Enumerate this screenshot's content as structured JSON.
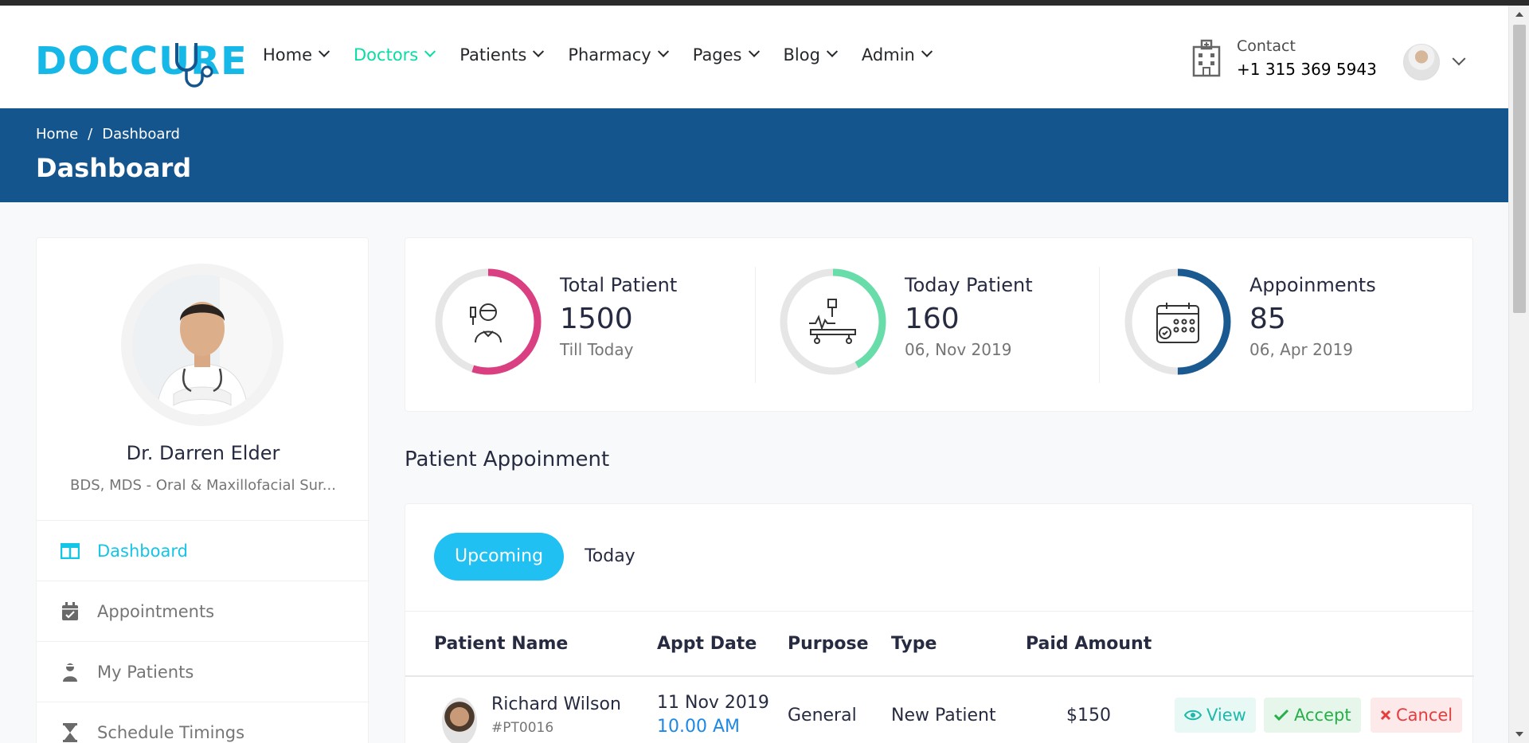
{
  "logo": {
    "text": "DOCCURE"
  },
  "nav": {
    "items": [
      {
        "label": "Home",
        "active": false
      },
      {
        "label": "Doctors",
        "active": true
      },
      {
        "label": "Patients",
        "active": false
      },
      {
        "label": "Pharmacy",
        "active": false
      },
      {
        "label": "Pages",
        "active": false
      },
      {
        "label": "Blog",
        "active": false
      },
      {
        "label": "Admin",
        "active": false
      }
    ]
  },
  "contact": {
    "label": "Contact",
    "phone": "+1 315 369 5943"
  },
  "breadcrumb": {
    "home": "Home",
    "sep": "/",
    "current": "Dashboard"
  },
  "page_title": "Dashboard",
  "profile": {
    "name": "Dr. Darren Elder",
    "specialty": "BDS, MDS - Oral & Maxillofacial Sur..."
  },
  "sidebar": {
    "items": [
      {
        "label": "Dashboard",
        "active": true,
        "icon": "columns-icon"
      },
      {
        "label": "Appointments",
        "active": false,
        "icon": "calendar-check-icon"
      },
      {
        "label": "My Patients",
        "active": false,
        "icon": "user-injured-icon"
      },
      {
        "label": "Schedule Timings",
        "active": false,
        "icon": "hourglass-icon"
      }
    ]
  },
  "stats": [
    {
      "title": "Total Patient",
      "value": "1500",
      "sub": "Till Today",
      "color": "#da3f81",
      "progress": 0.55
    },
    {
      "title": "Today Patient",
      "value": "160",
      "sub": "06, Nov 2019",
      "color": "#68dda9",
      "progress": 0.42
    },
    {
      "title": "Appoinments",
      "value": "85",
      "sub": "06, Apr 2019",
      "color": "#1b5a90",
      "progress": 0.5
    }
  ],
  "section_title": "Patient Appoinment",
  "tabs": {
    "upcoming": "Upcoming",
    "today": "Today"
  },
  "table": {
    "headers": [
      "Patient Name",
      "Appt Date",
      "Purpose",
      "Type",
      "Paid Amount"
    ],
    "rows": [
      {
        "name": "Richard Wilson",
        "id": "#PT0016",
        "date": "11 Nov 2019",
        "time": "10.00 AM",
        "purpose": "General",
        "type": "New Patient",
        "amount": "$150"
      }
    ]
  },
  "actions": {
    "view": "View",
    "accept": "Accept",
    "cancel": "Cancel"
  },
  "colors": {
    "brand": "#15b8e6",
    "nav_active": "#09dca4",
    "banner": "#15558d",
    "tab_active": "#20c0f3"
  }
}
